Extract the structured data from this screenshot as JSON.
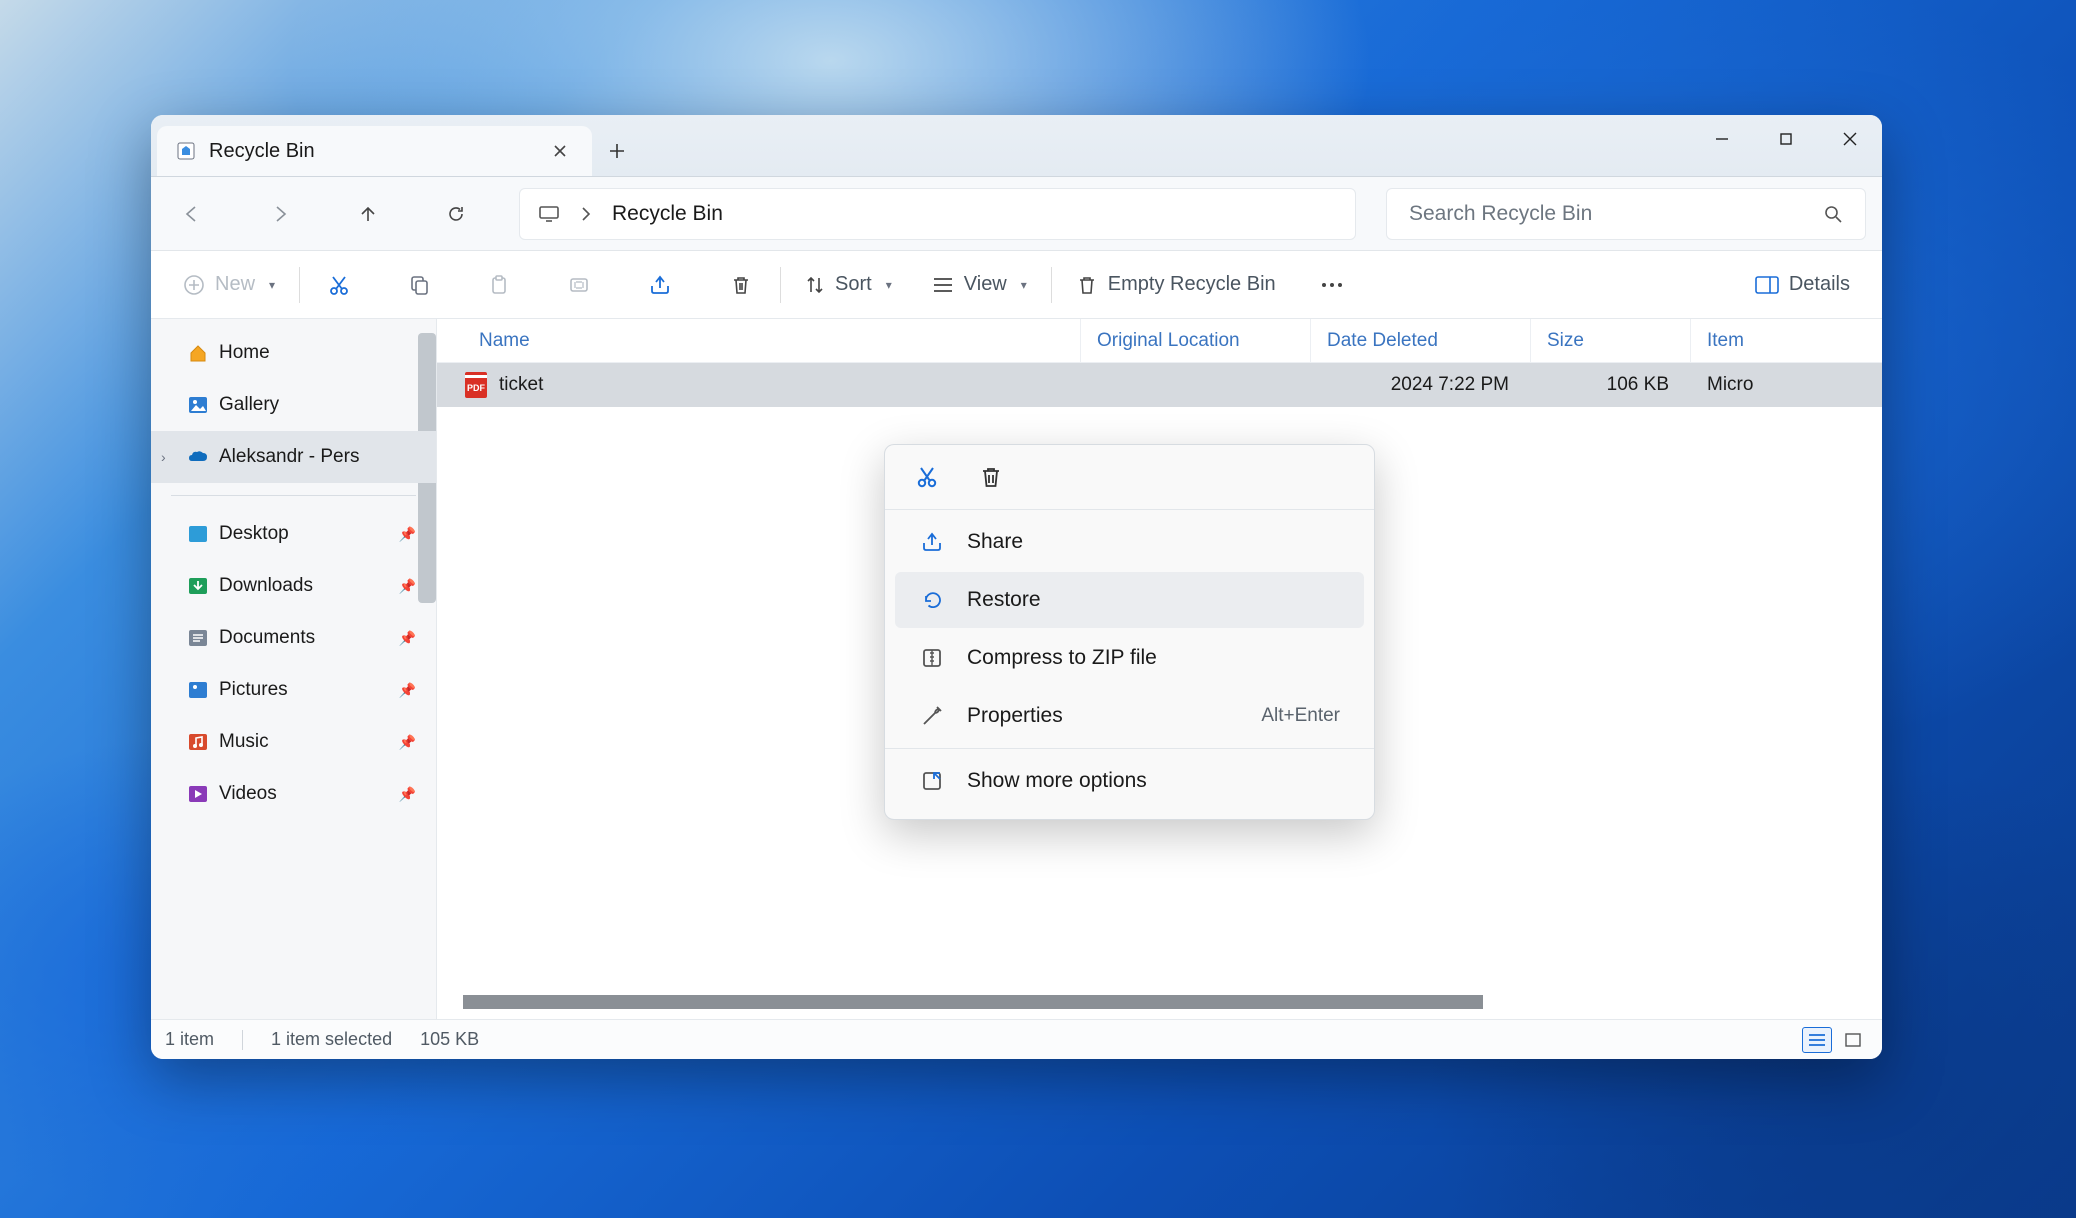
{
  "tab": {
    "title": "Recycle Bin"
  },
  "address": {
    "path": "Recycle Bin"
  },
  "search": {
    "placeholder": "Search Recycle Bin"
  },
  "toolbar": {
    "new": "New",
    "sort": "Sort",
    "view": "View",
    "empty": "Empty Recycle Bin",
    "details": "Details"
  },
  "sidebar": {
    "top": [
      {
        "label": "Home",
        "icon": "home"
      },
      {
        "label": "Gallery",
        "icon": "gallery"
      },
      {
        "label": "Aleksandr - Pers",
        "icon": "onedrive",
        "selected": true,
        "expand": true
      }
    ],
    "pinned": [
      {
        "label": "Desktop",
        "icon": "desktop"
      },
      {
        "label": "Downloads",
        "icon": "downloads"
      },
      {
        "label": "Documents",
        "icon": "documents"
      },
      {
        "label": "Pictures",
        "icon": "pictures"
      },
      {
        "label": "Music",
        "icon": "music"
      },
      {
        "label": "Videos",
        "icon": "videos"
      }
    ]
  },
  "columns": {
    "name": "Name",
    "orig": "Original Location",
    "date": "Date Deleted",
    "size": "Size",
    "type": "Item"
  },
  "rows": [
    {
      "name": "ticket",
      "orig": "",
      "date": "2024 7:22 PM",
      "size": "106 KB",
      "type": "Micro"
    }
  ],
  "status": {
    "count": "1 item",
    "selected": "1 item selected",
    "size": "105 KB"
  },
  "context": {
    "share": "Share",
    "restore": "Restore",
    "compress": "Compress to ZIP file",
    "properties": "Properties",
    "properties_shortcut": "Alt+Enter",
    "more": "Show more options"
  }
}
